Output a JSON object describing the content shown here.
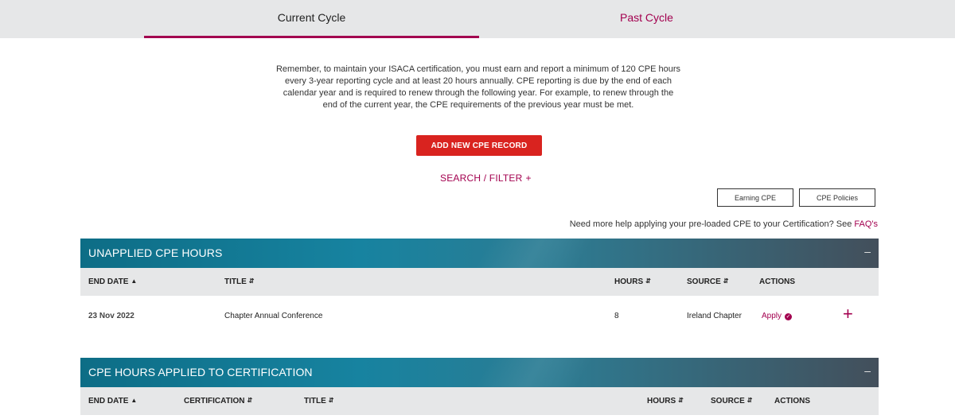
{
  "tabs": [
    {
      "label": "Current Cycle",
      "active": true
    },
    {
      "label": "Past Cycle",
      "active": false
    }
  ],
  "intro_text": "Remember, to maintain your ISACA certification, you must earn and report a minimum of 120 CPE hours every 3-year reporting cycle and at least 20 hours annually. CPE reporting is due by the end of each calendar year and is required to renew through the following year. For example, to renew through the end of the current year, the CPE requirements of the previous year must be met.",
  "add_button": "ADD NEW CPE RECORD",
  "search_filter": {
    "label": "SEARCH / FILTER",
    "icon": "+"
  },
  "buttons": {
    "earning": "Earning CPE",
    "policies": "CPE Policies"
  },
  "help": {
    "text": "Need more help applying your pre-loaded CPE to your Certification? See ",
    "link": "FAQ's"
  },
  "unapplied": {
    "title": "UNAPPLIED CPE HOURS",
    "toggle": "–",
    "columns": {
      "end_date": "END DATE",
      "title": "TITLE",
      "hours": "HOURS",
      "source": "SOURCE",
      "actions": "ACTIONS"
    },
    "rows": [
      {
        "end_date": "23 Nov 2022",
        "title": "Chapter Annual Conference",
        "hours": "8",
        "source": "Ireland Chapter",
        "action": "Apply",
        "expand": "+"
      }
    ]
  },
  "applied": {
    "title": "CPE HOURS APPLIED TO CERTIFICATION",
    "toggle": "–",
    "columns": {
      "end_date": "END DATE",
      "certification": "CERTIFICATION",
      "title": "TITLE",
      "hours": "HOURS",
      "source": "SOURCE",
      "actions": "ACTIONS"
    }
  },
  "colors": {
    "accent": "#a3004f",
    "primary_button": "#d9231f",
    "header_teal": "#1783a0"
  }
}
